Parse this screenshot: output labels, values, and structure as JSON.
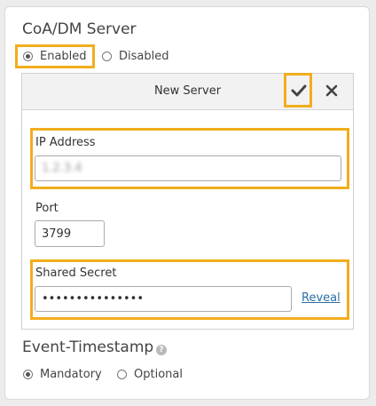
{
  "coa_dm": {
    "title": "CoA/DM Server",
    "enabled_label": "Enabled",
    "disabled_label": "Disabled",
    "selected": "Enabled"
  },
  "panel": {
    "title": "New Server",
    "confirm_icon": "check-icon",
    "close_icon": "close-icon"
  },
  "ip_address": {
    "label": "IP Address",
    "value": "1.2.3.4"
  },
  "port": {
    "label": "Port",
    "value": "3799"
  },
  "shared_secret": {
    "label": "Shared Secret",
    "value": "•••••••••••••••",
    "reveal_label": "Reveal"
  },
  "event_timestamp": {
    "title": "Event-Timestamp",
    "help_icon": "help-icon",
    "mandatory_label": "Mandatory",
    "optional_label": "Optional",
    "selected": "Mandatory"
  },
  "colors": {
    "highlight": "#f2ad1d",
    "link": "#2a6ea8"
  }
}
